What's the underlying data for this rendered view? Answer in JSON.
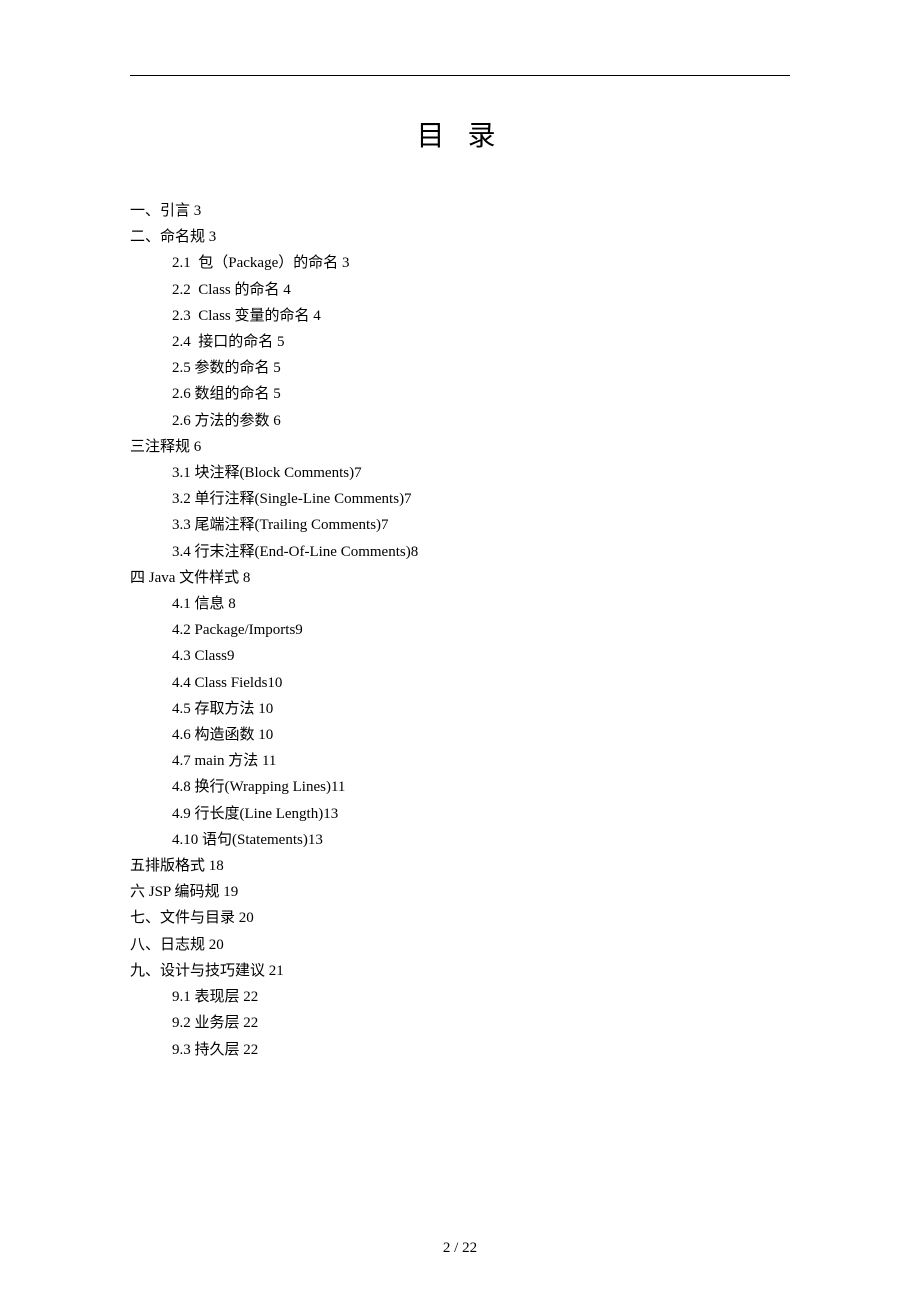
{
  "title": "目 录",
  "toc": [
    {
      "level": 0,
      "text": "一、引言 3"
    },
    {
      "level": 0,
      "text": "二、命名规 3"
    },
    {
      "level": 1,
      "text": "2.1  包（Package）的命名 3"
    },
    {
      "level": 1,
      "text": "2.2  Class 的命名 4"
    },
    {
      "level": 1,
      "text": "2.3  Class 变量的命名 4"
    },
    {
      "level": 1,
      "text": "2.4  接口的命名 5"
    },
    {
      "level": 1,
      "text": "2.5 参数的命名 5"
    },
    {
      "level": 1,
      "text": "2.6 数组的命名 5"
    },
    {
      "level": 1,
      "text": "2.6 方法的参数 6"
    },
    {
      "level": 0,
      "text": "三注释规 6"
    },
    {
      "level": 1,
      "text": "3.1 块注释(Block Comments)7"
    },
    {
      "level": 1,
      "text": "3.2 单行注释(Single-Line Comments)7"
    },
    {
      "level": 1,
      "text": "3.3 尾端注释(Trailing Comments)7"
    },
    {
      "level": 1,
      "text": "3.4 行末注释(End-Of-Line Comments)8"
    },
    {
      "level": 0,
      "text": "四 Java 文件样式 8"
    },
    {
      "level": 1,
      "text": "4.1 信息 8"
    },
    {
      "level": 1,
      "text": "4.2 Package/Imports9"
    },
    {
      "level": 1,
      "text": "4.3 Class9"
    },
    {
      "level": 1,
      "text": "4.4 Class Fields10"
    },
    {
      "level": 1,
      "text": "4.5 存取方法 10"
    },
    {
      "level": 1,
      "text": "4.6 构造函数 10"
    },
    {
      "level": 1,
      "text": "4.7 main 方法 11"
    },
    {
      "level": 1,
      "text": "4.8 换行(Wrapping Lines)11"
    },
    {
      "level": 1,
      "text": "4.9 行长度(Line Length)13"
    },
    {
      "level": 1,
      "text": "4.10 语句(Statements)13"
    },
    {
      "level": 0,
      "text": "五排版格式 18"
    },
    {
      "level": 0,
      "text": "六 JSP 编码规 19"
    },
    {
      "level": 0,
      "text": "七、文件与目录 20"
    },
    {
      "level": 0,
      "text": "八、日志规 20"
    },
    {
      "level": 0,
      "text": "九、设计与技巧建议 21"
    },
    {
      "level": 1,
      "text": "9.1 表现层 22"
    },
    {
      "level": 1,
      "text": "9.2 业务层 22"
    },
    {
      "level": 1,
      "text": "9.3 持久层 22"
    }
  ],
  "footer": "2  /  22"
}
